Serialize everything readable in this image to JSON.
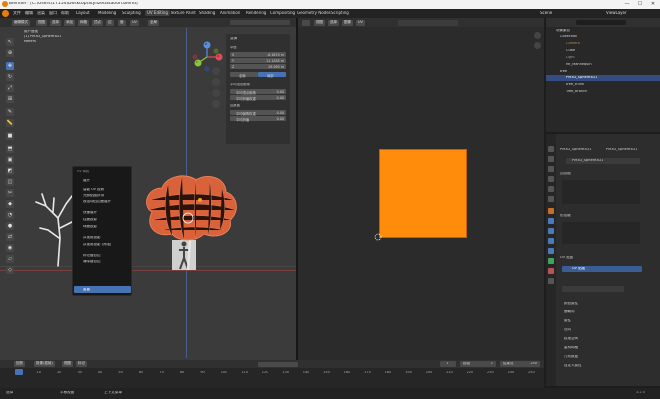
{
  "window": {
    "title": "Blender* [C:\\Users\\17154\\Desktop\\StylizedStation.blend]",
    "min": "—",
    "max": "☐",
    "close": "✕"
  },
  "menubar": {
    "items": [
      "文件",
      "编辑",
      "渲染",
      "窗口",
      "帮助"
    ],
    "workspaces": [
      "Layout",
      "Modeling",
      "Sculpting",
      "UV Editing",
      "Texture Paint",
      "Shading",
      "Animation",
      "Rendering",
      "Compositing",
      "Geometry Nodes",
      "Scripting"
    ],
    "active_workspace": "UV Editing",
    "scene": "Scene",
    "view_layer": "ViewLayer"
  },
  "viewport": {
    "mode": "编辑模式",
    "header_chips": [
      "视图",
      "选择",
      "添加",
      "网格",
      "顶点",
      "边",
      "面",
      "UV"
    ],
    "orientation": "全局",
    "info_line1": "用户透视",
    "info_line2": "(1) PM3D_Sphere3D1",
    "info_line3": "Meters",
    "gizmo": {
      "x": "X",
      "y": "Y",
      "z": "Z"
    }
  },
  "n_panel": {
    "title": "变换",
    "section_vertex": "中值",
    "fields": [
      {
        "label": "X",
        "value": "-6.1674 m"
      },
      {
        "label": "Y",
        "value": "11.1285 m"
      },
      {
        "label": "Z",
        "value": "29.095 m"
      }
    ],
    "toggle_left": "全局",
    "toggle_right": "局部",
    "section_crease": "平均顶点倒角",
    "crease_rows": [
      {
        "label": "平均顶点倒角",
        "value": "0.00"
      },
      {
        "label": "平均折痕权重",
        "value": "0.00"
      }
    ],
    "section_edge": "边数据",
    "edge_rows": [
      {
        "label": "平均倒角权重",
        "value": "0.00"
      },
      {
        "label": "平均折痕",
        "value": "0.00"
      }
    ]
  },
  "context_menu": {
    "title": "UV 映射",
    "items": [
      "展开",
      "智能 UV 投射",
      "光照贴图拼排",
      "按活动四边面展开",
      "快速展开",
      "柱面投影",
      "球面投影",
      "从视角投影",
      "从视角投影 (界限)",
      "标记缝合边",
      "清除缝合边",
      "重置"
    ],
    "highlighted": "重置"
  },
  "uv_editor": {
    "header_chips": [
      "视图",
      "选择",
      "图像",
      "UV"
    ],
    "image_name": "",
    "square_color": "#ff8c0a"
  },
  "outliner": {
    "title": "场景集合",
    "rows": [
      {
        "name": "Collection",
        "indent": 1,
        "selected": false
      },
      {
        "name": "Camera",
        "indent": 2,
        "selected": false
      },
      {
        "name": "Cube",
        "indent": 2,
        "selected": false
      },
      {
        "name": "Light",
        "indent": 2,
        "selected": false
      },
      {
        "name": "Mr_Mannequin",
        "indent": 2,
        "selected": false
      },
      {
        "name": "tree",
        "indent": 1,
        "selected": false
      },
      {
        "name": "PM3D_Sphere3D1",
        "indent": 2,
        "selected": true
      },
      {
        "name": "tree_trunk",
        "indent": 2,
        "selected": false
      },
      {
        "name": "Tree_branch",
        "indent": 2,
        "selected": false
      }
    ]
  },
  "properties": {
    "breadcrumb_obj": "PM3D_Sphere3D1",
    "breadcrumb_data": "PM3D_Sphere3D1",
    "mesh_name": "PM3D_Sphere3D1",
    "vgroup_title": "顶点组",
    "shapekey_title": "形态键",
    "uv_title": "UV 贴图",
    "uv_map": "UV 贴图",
    "sections": [
      "颜色属性",
      "面朝向",
      "属性",
      "法向",
      "纹理空间",
      "重构网格",
      "几何数据",
      "自定义属性"
    ]
  },
  "timeline": {
    "controls": [
      "回放",
      "抠像(插帧)",
      "视图",
      "标记"
    ],
    "current_frame": "1",
    "start_label": "起始",
    "start": "1",
    "end_label": "结束点",
    "end": "250",
    "ticks": [
      "0",
      "10",
      "20",
      "30",
      "40",
      "50",
      "60",
      "70",
      "80",
      "90",
      "100",
      "110",
      "120",
      "130",
      "140",
      "150",
      "160",
      "170",
      "180",
      "190",
      "200",
      "210",
      "220",
      "230",
      "240",
      "250"
    ]
  },
  "statusbar": {
    "left": "选择",
    "middle": "平移视图",
    "right": "上下文菜单",
    "version": "3.2.0"
  },
  "colors": {
    "accent": "#4772b3",
    "uv_square": "#ff8c0a",
    "tree_foliage": "#d9623a"
  }
}
